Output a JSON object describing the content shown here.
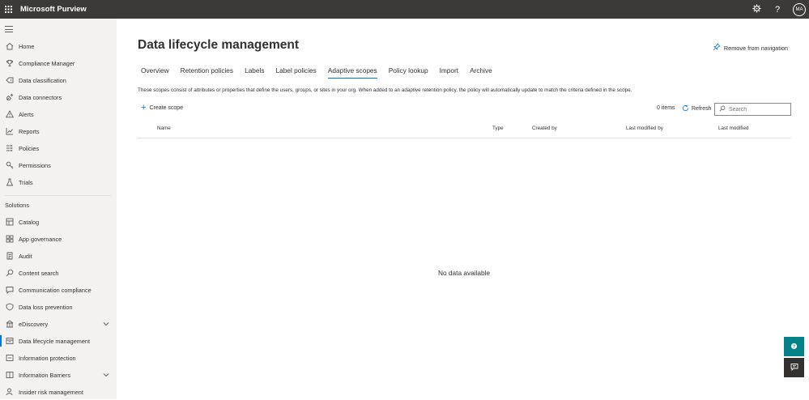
{
  "topbar": {
    "app_title": "Microsoft Purview",
    "settings_icon": "gear-icon",
    "help_label": "?",
    "avatar_initials": "MA"
  },
  "sidebar": {
    "items": [
      {
        "label": "Home",
        "icon": "home-icon"
      },
      {
        "label": "Compliance Manager",
        "icon": "trophy-icon"
      },
      {
        "label": "Data classification",
        "icon": "tag-icon"
      },
      {
        "label": "Data connectors",
        "icon": "plug-icon"
      },
      {
        "label": "Alerts",
        "icon": "warning-icon"
      },
      {
        "label": "Reports",
        "icon": "chart-icon"
      },
      {
        "label": "Policies",
        "icon": "policies-icon"
      },
      {
        "label": "Permissions",
        "icon": "key-icon"
      },
      {
        "label": "Trials",
        "icon": "flask-icon"
      }
    ],
    "solutions_heading": "Solutions",
    "solutions": [
      {
        "label": "Catalog",
        "icon": "catalog-icon"
      },
      {
        "label": "App governance",
        "icon": "app-icon"
      },
      {
        "label": "Audit",
        "icon": "audit-icon"
      },
      {
        "label": "Content search",
        "icon": "search-icon"
      },
      {
        "label": "Communication compliance",
        "icon": "chat-icon"
      },
      {
        "label": "Data loss prevention",
        "icon": "shield-icon"
      },
      {
        "label": "eDiscovery",
        "icon": "ediscovery-icon"
      },
      {
        "label": "Data lifecycle management",
        "icon": "lifecycle-icon"
      },
      {
        "label": "Information protection",
        "icon": "lock-icon"
      },
      {
        "label": "Information Barriers",
        "icon": "barrier-icon"
      },
      {
        "label": "Insider risk management",
        "icon": "person-icon"
      }
    ]
  },
  "main": {
    "title": "Data lifecycle management",
    "remove_nav_label": "Remove from navigation",
    "tabs": [
      "Overview",
      "Retention policies",
      "Labels",
      "Label policies",
      "Adaptive scopes",
      "Policy lookup",
      "Import",
      "Archive"
    ],
    "active_tab": "Adaptive scopes",
    "description": "These scopes consist of attributes or properties that define the users, groups, or sites in your org. When added to an adaptive retention policy, the policy will automatically update to match the criteria defined in the scope.",
    "create_label": "Create scope",
    "count_label": "0 items",
    "refresh_label": "Refresh",
    "search_placeholder": "Search",
    "columns": [
      "Name",
      "Type",
      "Created by",
      "Last modified by",
      "Last modified"
    ],
    "empty_text": "No data available"
  },
  "colors": {
    "topbar": "#3c3a38",
    "sidebar": "#f3f2f1",
    "accent": "#0078d4",
    "fab_teal": "#038387",
    "fab_dark": "#323130"
  }
}
